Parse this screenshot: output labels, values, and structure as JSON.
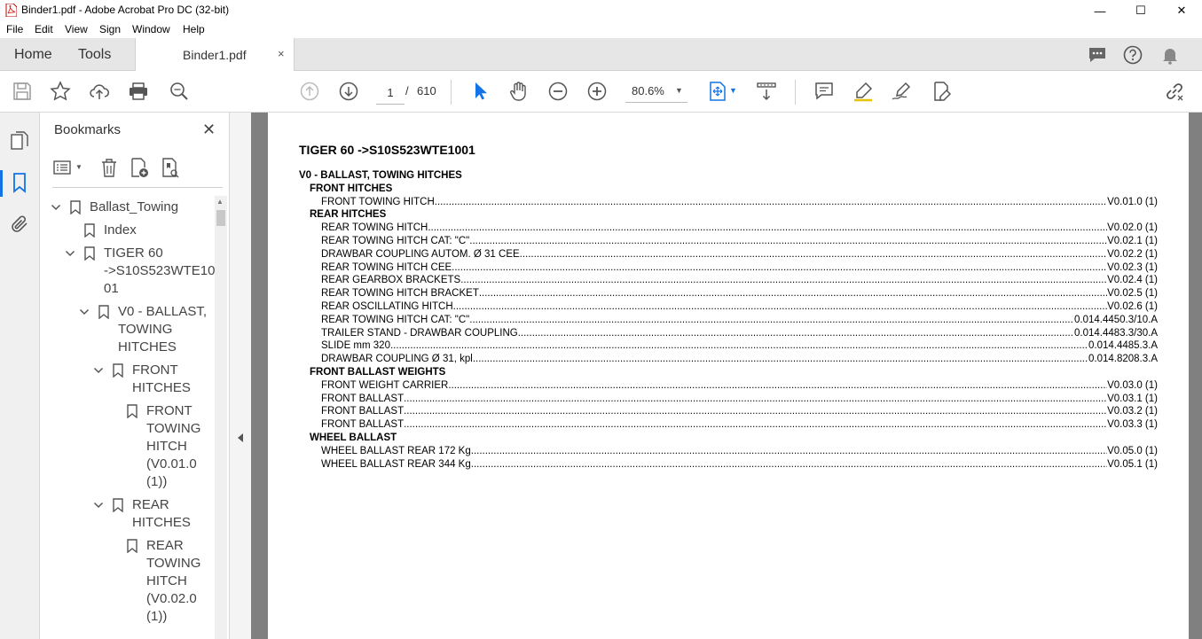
{
  "window": {
    "title": "Binder1.pdf - Adobe Acrobat Pro DC (32-bit)",
    "minimize": "—",
    "maximize": "☐",
    "close": "✕"
  },
  "menu": [
    "File",
    "Edit",
    "View",
    "Sign",
    "Window",
    "Help"
  ],
  "tabs": {
    "home": "Home",
    "tools": "Tools",
    "document": "Binder1.pdf",
    "close": "×"
  },
  "toolbar": {
    "current_page": "1",
    "page_separator": "/",
    "total_pages": "610",
    "zoom": "80.6%",
    "accent": "#1473e6"
  },
  "bookmarks_panel": {
    "title": "Bookmarks",
    "close": "✕",
    "items": [
      {
        "lines": [
          "Ballast_Towing"
        ],
        "level": 0,
        "expanded": true
      },
      {
        "lines": [
          "Index"
        ],
        "level": 1,
        "expanded": null
      },
      {
        "lines": [
          "TIGER 60",
          "->S10S523WTE10",
          "01"
        ],
        "level": 1,
        "expanded": true
      },
      {
        "lines": [
          "V0 - BALLAST,",
          "TOWING",
          "HITCHES"
        ],
        "level": 2,
        "expanded": true
      },
      {
        "lines": [
          "FRONT",
          "HITCHES"
        ],
        "level": 3,
        "expanded": true
      },
      {
        "lines": [
          "FRONT",
          "TOWING",
          "HITCH",
          "(V0.01.0",
          "(1))"
        ],
        "level": 4,
        "expanded": null
      },
      {
        "lines": [
          "REAR",
          "HITCHES"
        ],
        "level": 3,
        "expanded": true
      },
      {
        "lines": [
          "REAR",
          "TOWING",
          "HITCH",
          "(V0.02.0",
          "(1))"
        ],
        "level": 4,
        "expanded": null
      }
    ]
  },
  "document": {
    "title": "TIGER 60 ->S10S523WTE1001",
    "toc": [
      {
        "kind": "h1",
        "text": "V0 - BALLAST, TOWING HITCHES"
      },
      {
        "kind": "h2",
        "text": "FRONT HITCHES"
      },
      {
        "kind": "entry",
        "text": "FRONT TOWING HITCH",
        "ref": "V0.01.0 (1)"
      },
      {
        "kind": "h2",
        "text": "REAR HITCHES"
      },
      {
        "kind": "entry",
        "text": "REAR TOWING HITCH",
        "ref": "V0.02.0 (1)"
      },
      {
        "kind": "entry",
        "text": "REAR TOWING HITCH CAT: \"C\"",
        "ref": "V0.02.1 (1)"
      },
      {
        "kind": "entry",
        "text": "DRAWBAR COUPLING AUTOM. Ø 31 CEE",
        "ref": "V0.02.2 (1)"
      },
      {
        "kind": "entry",
        "text": "REAR TOWING HITCH CEE",
        "ref": "V0.02.3 (1)"
      },
      {
        "kind": "entry",
        "text": "REAR GEARBOX BRACKETS",
        "ref": "V0.02.4 (1)"
      },
      {
        "kind": "entry",
        "text": "REAR TOWING HITCH BRACKET",
        "ref": "V0.02.5 (1)"
      },
      {
        "kind": "entry",
        "text": "REAR OSCILLATING HITCH",
        "ref": "V0.02.6 (1)"
      },
      {
        "kind": "entry",
        "text": "REAR TOWING HITCH CAT: \"C\"",
        "ref": "0.014.4450.3/10.A"
      },
      {
        "kind": "entry",
        "text": "TRAILER STAND - DRAWBAR COUPLING",
        "ref": "0.014.4483.3/30.A"
      },
      {
        "kind": "entry",
        "text": "SLIDE mm 320",
        "ref": "0.014.4485.3.A"
      },
      {
        "kind": "entry",
        "text": "DRAWBAR COUPLING Ø 31, kpl.",
        "ref": "0.014.8208.3.A"
      },
      {
        "kind": "h2",
        "text": "FRONT BALLAST WEIGHTS"
      },
      {
        "kind": "entry",
        "text": "FRONT WEIGHT CARRIER",
        "ref": "V0.03.0 (1)"
      },
      {
        "kind": "entry",
        "text": "FRONT BALLAST",
        "ref": "V0.03.1 (1)"
      },
      {
        "kind": "entry",
        "text": "FRONT BALLAST",
        "ref": "V0.03.2 (1)"
      },
      {
        "kind": "entry",
        "text": "FRONT BALLAST",
        "ref": "V0.03.3 (1)"
      },
      {
        "kind": "h2",
        "text": "WHEEL BALLAST"
      },
      {
        "kind": "entry",
        "text": "WHEEL BALLAST REAR 172 Kg",
        "ref": "V0.05.0 (1)"
      },
      {
        "kind": "entry",
        "text": "WHEEL BALLAST REAR 344 Kg",
        "ref": "V0.05.1 (1)"
      }
    ]
  }
}
